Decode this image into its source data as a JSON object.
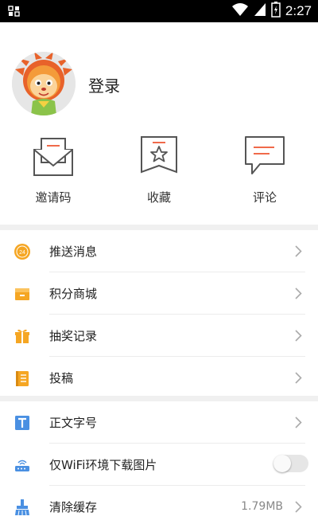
{
  "status_bar": {
    "time": "2:27",
    "icons": [
      "notification-icon",
      "wifi-icon",
      "signal-icon",
      "battery-icon"
    ]
  },
  "profile": {
    "login_label": "登录",
    "avatar_icon": "lion-mascot-avatar"
  },
  "quick_actions": [
    {
      "label": "邀请码",
      "icon": "envelope-icon"
    },
    {
      "label": "收藏",
      "icon": "star-bookmark-icon"
    },
    {
      "label": "评论",
      "icon": "comment-icon"
    }
  ],
  "menu_group_1": [
    {
      "label": "推送消息",
      "icon": "push-message-icon"
    },
    {
      "label": "积分商城",
      "icon": "points-store-icon"
    },
    {
      "label": "抽奖记录",
      "icon": "gift-icon"
    },
    {
      "label": "投稿",
      "icon": "submission-icon"
    }
  ],
  "menu_group_2": [
    {
      "label": "正文字号",
      "icon": "font-size-icon"
    },
    {
      "label": "仅WiFi环境下载图片",
      "icon": "wifi-router-icon",
      "toggle_on": false
    },
    {
      "label": "清除缓存",
      "icon": "clear-cache-icon",
      "value": "1.79MB"
    }
  ],
  "colors": {
    "accent_orange": "#f5a623",
    "accent_red": "#f06a4a",
    "icon_blue": "#4a90e2",
    "divider": "#f0f0f0",
    "status_bar": "#000000"
  }
}
